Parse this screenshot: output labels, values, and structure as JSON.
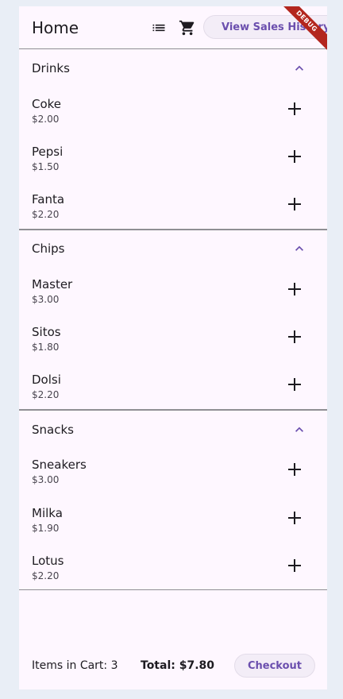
{
  "appbar": {
    "title": "Home",
    "list_icon": "list-icon",
    "cart_icon": "shopping-cart-icon",
    "sales_button": "View Sales History",
    "debug_banner": "DEBUG"
  },
  "categories": [
    {
      "name": "Drinks",
      "expanded": true,
      "items": [
        {
          "name": "Coke",
          "price": "$2.00"
        },
        {
          "name": "Pepsi",
          "price": "$1.50"
        },
        {
          "name": "Fanta",
          "price": "$2.20"
        }
      ]
    },
    {
      "name": "Chips",
      "expanded": true,
      "items": [
        {
          "name": "Master",
          "price": "$3.00"
        },
        {
          "name": "Sitos",
          "price": "$1.80"
        },
        {
          "name": "Dolsi",
          "price": "$2.20"
        }
      ]
    },
    {
      "name": "Snacks",
      "expanded": true,
      "items": [
        {
          "name": "Sneakers",
          "price": "$3.00"
        },
        {
          "name": "Milka",
          "price": "$1.90"
        },
        {
          "name": "Lotus",
          "price": "$2.20"
        }
      ]
    }
  ],
  "footer": {
    "items_in_cart": "Items in Cart: 3",
    "total": "Total: $7.80",
    "checkout_label": "Checkout"
  },
  "colors": {
    "accent": "#6b4fae",
    "surface": "#fef7ff",
    "background": "#e9eef6",
    "debug": "#b3261e"
  }
}
